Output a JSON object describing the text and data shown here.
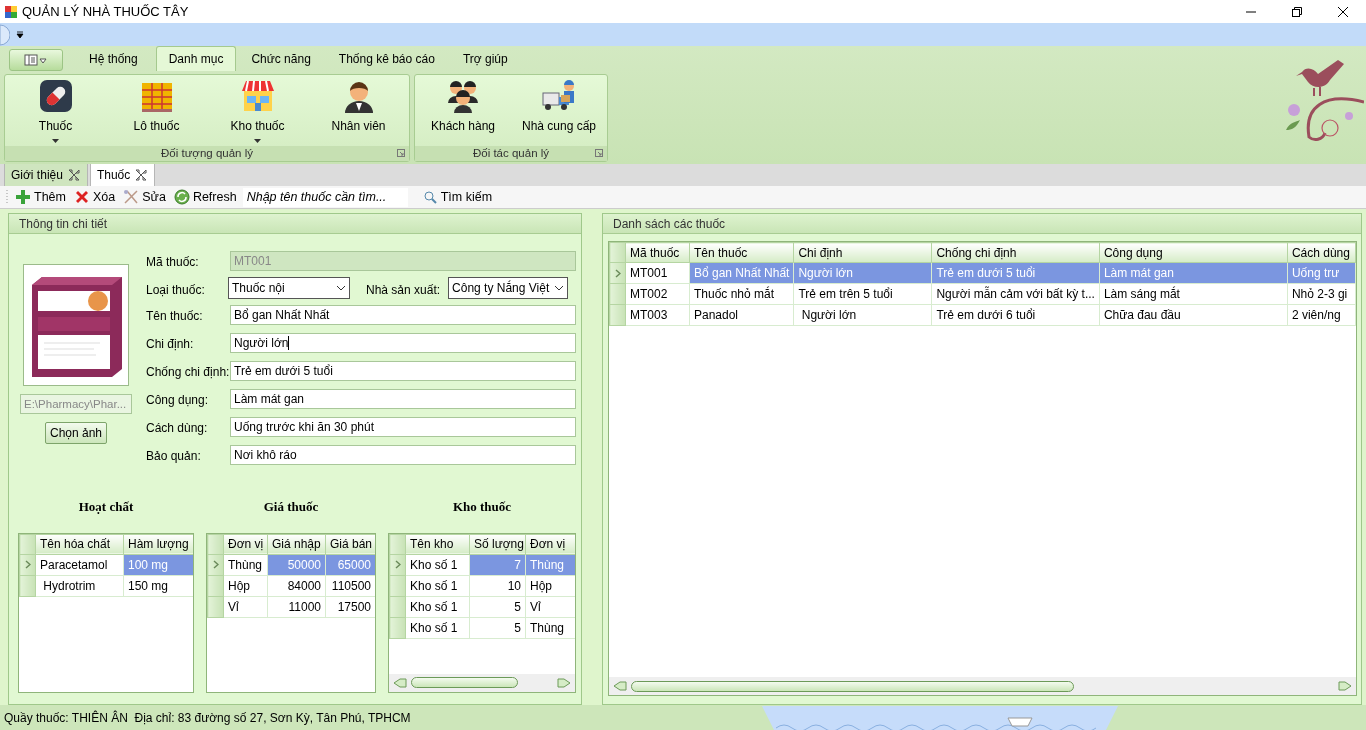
{
  "window": {
    "title": "QUẢN LÝ NHÀ THUỐC TÂY"
  },
  "ribbon": {
    "tabs": [
      {
        "label": "Hệ thống",
        "selected": false
      },
      {
        "label": "Danh mục",
        "selected": true
      },
      {
        "label": "Chức năng",
        "selected": false
      },
      {
        "label": "Thống kê báo cáo",
        "selected": false
      },
      {
        "label": "Trợ giúp",
        "selected": false
      }
    ],
    "groups": [
      {
        "title": "Đối tượng quản lý",
        "items": [
          {
            "label": "Thuốc",
            "dropdown": true
          },
          {
            "label": "Lô thuốc",
            "dropdown": false
          },
          {
            "label": "Kho thuốc",
            "dropdown": true
          },
          {
            "label": "Nhân viên",
            "dropdown": false
          }
        ]
      },
      {
        "title": "Đối tác quản lý",
        "items": [
          {
            "label": "Khách hàng",
            "dropdown": false
          },
          {
            "label": "Nhà cung cấp",
            "dropdown": false
          }
        ]
      }
    ]
  },
  "doc_tabs": [
    {
      "label": "Giới thiệu",
      "selected": false
    },
    {
      "label": "Thuốc",
      "selected": true
    }
  ],
  "toolbar": {
    "buttons": [
      {
        "label": "Thêm"
      },
      {
        "label": "Xóa"
      },
      {
        "label": "Sửa"
      },
      {
        "label": "Refresh"
      }
    ],
    "search": {
      "placeholder": "Nhập tên thuốc cần tìm..."
    },
    "search_button": {
      "label": "Tìm kiếm"
    }
  },
  "detail": {
    "title": "Thông tin chi tiết",
    "image_path": "E:\\Pharmacy\\Phar...",
    "choose_button": "Chọn ảnh",
    "fields": [
      {
        "label": "Mã thuốc:",
        "kind": "readonly",
        "value": "MT001",
        "focused": false
      },
      {
        "label": "Loại thuốc:",
        "kind": "select",
        "value": "Thuốc nội",
        "focused": false,
        "side": {
          "label": "Nhà sản xuất:",
          "kind": "select",
          "value": "Công ty Nắng Việt"
        }
      },
      {
        "label": "Tên thuốc:",
        "kind": "text",
        "value": "Bổ gan Nhất Nhất",
        "focused": false
      },
      {
        "label": "Chi định:",
        "kind": "text",
        "value": "Người lớn",
        "focused": true
      },
      {
        "label": "Chống chi định:",
        "kind": "text",
        "value": "Trẻ em dưới 5 tuổi",
        "focused": false
      },
      {
        "label": "Công dụng:",
        "kind": "text",
        "value": "Làm mát gan",
        "focused": false
      },
      {
        "label": "Cách dùng:",
        "kind": "text",
        "value": "Uống trước khi ăn 30 phút",
        "focused": false
      },
      {
        "label": "Bảo quản:",
        "kind": "text",
        "value": "Nơi khô ráo",
        "focused": false
      }
    ],
    "grids": [
      {
        "title": "Hoạt chất",
        "horizontal_scrollbar": false,
        "columns": [
          {
            "label": "Tên hóa chất",
            "numeric": false
          },
          {
            "label": "Hàm lượng",
            "numeric": false
          }
        ],
        "rows": [
          {
            "selected": true,
            "cells": [
              "Paracetamol",
              "100 mg"
            ]
          },
          {
            "selected": false,
            "cells": [
              " Hydrotrim",
              "150 mg"
            ]
          }
        ]
      },
      {
        "title": "Giá thuốc",
        "horizontal_scrollbar": false,
        "columns": [
          {
            "label": "Đơn vị",
            "numeric": false
          },
          {
            "label": "Giá nhập",
            "numeric": true
          },
          {
            "label": "Giá bán",
            "numeric": true
          }
        ],
        "rows": [
          {
            "selected": true,
            "cells": [
              "Thùng",
              "50000",
              "65000"
            ]
          },
          {
            "selected": false,
            "cells": [
              "Hộp",
              "84000",
              "110500"
            ]
          },
          {
            "selected": false,
            "cells": [
              "Vỉ",
              "11000",
              "17500"
            ]
          }
        ]
      },
      {
        "title": "Kho thuốc",
        "horizontal_scrollbar": true,
        "columns": [
          {
            "label": "Tên kho",
            "numeric": false
          },
          {
            "label": "Số lượng",
            "numeric": true
          },
          {
            "label": "Đơn vị",
            "numeric": false
          }
        ],
        "rows": [
          {
            "selected": true,
            "cells": [
              "Kho số 1",
              "7",
              "Thùng"
            ]
          },
          {
            "selected": false,
            "cells": [
              "Kho số 1",
              "10",
              "Hộp"
            ]
          },
          {
            "selected": false,
            "cells": [
              "Kho số 1",
              "5",
              "Vỉ"
            ]
          },
          {
            "selected": false,
            "cells": [
              "Kho số 1",
              "5",
              "Thùng"
            ]
          }
        ]
      }
    ]
  },
  "list": {
    "title": "Danh sách các thuốc",
    "horizontal_scrollbar": true,
    "columns": [
      {
        "label": "Mã thuốc",
        "numeric": false
      },
      {
        "label": "Tên thuốc",
        "numeric": false
      },
      {
        "label": "Chi định",
        "numeric": false
      },
      {
        "label": "Chống chi định",
        "numeric": false
      },
      {
        "label": "Công dụng",
        "numeric": false
      },
      {
        "label": "Cách dùng",
        "numeric": false
      }
    ],
    "rows": [
      {
        "selected": true,
        "cells": [
          "MT001",
          "Bổ gan Nhất Nhất",
          "Người lớn",
          "Trẻ em dưới 5 tuổi",
          "Làm mát gan",
          "Uống trư"
        ]
      },
      {
        "selected": false,
        "cells": [
          "MT002",
          "Thuốc nhỏ mắt",
          "Trẻ em trên 5 tuổi",
          "Người mẫn cảm với bất kỳ t...",
          "Làm sáng mắt",
          "Nhỏ 2-3 gi"
        ]
      },
      {
        "selected": false,
        "cells": [
          "MT003",
          "Panadol",
          " Người lớn",
          "Trẻ em dưới 6 tuổi",
          "Chữa đau đầu",
          "2 viên/ng"
        ]
      }
    ]
  },
  "status_bar": {
    "text": "Quầy thuốc: THIÊN ÂN  Địa chỉ: 83 đường số 27, Sơn Kỳ, Tân Phú, TPHCM"
  }
}
